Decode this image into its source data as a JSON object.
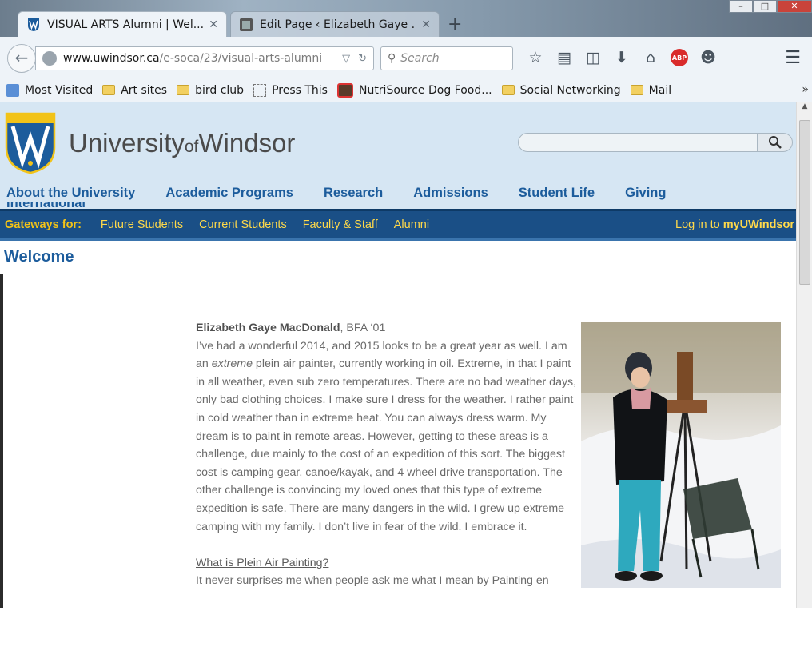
{
  "browser": {
    "tabs": [
      {
        "title": "VISUAL ARTS Alumni | Wel...",
        "active": true
      },
      {
        "title": "Edit Page ‹ Elizabeth Gaye ...",
        "active": false
      }
    ],
    "url_host": "www.uwindsor.ca",
    "url_path": "/e-soca/23/visual-arts-alumni",
    "search_placeholder": "Search",
    "abp_label": "ABP",
    "bookmarks": [
      {
        "label": "Most Visited",
        "icon": "blue-square"
      },
      {
        "label": "Art sites",
        "icon": "folder"
      },
      {
        "label": "bird club",
        "icon": "folder"
      },
      {
        "label": "Press This",
        "icon": "dashed"
      },
      {
        "label": "NutriSource Dog Food...",
        "icon": "dog"
      },
      {
        "label": "Social Networking",
        "icon": "folder"
      },
      {
        "label": "Mail",
        "icon": "folder"
      }
    ]
  },
  "site": {
    "name_main": "University",
    "name_of": "of",
    "name_end": "Windsor",
    "nav": [
      "About the University",
      "Academic Programs",
      "Research",
      "Admissions",
      "Student Life",
      "Giving"
    ],
    "nav_overflow": "International",
    "gateways_label": "Gateways for:",
    "gateways": [
      "Future Students",
      "Current Students",
      "Faculty & Staff",
      "Alumni"
    ],
    "login_prefix": "Log in to ",
    "login_brand": "myUWindsor",
    "page_title": "Welcome"
  },
  "article": {
    "author": "Elizabeth Gaye MacDonald",
    "degree": ", BFA ‘01",
    "intro_a": "I’ve had a wonderful 2014, and 2015 looks to be a great year as well.  I am an ",
    "intro_em": "extreme",
    "intro_b": " plein air painter, currently working in oil.  Extreme, in that I paint in all weather, even sub zero temperatures.  There are no bad weather days, only bad clothing choices.  I make sure I dress for the weather.  I rather paint in cold weather than in extreme heat.  You can always dress warm.  My dream is to paint in remote areas.  However, getting to these areas is a challenge, due mainly to the cost of an expedition of this sort.  The biggest cost is camping gear, canoe/kayak, and 4 wheel drive transportation.  The other challenge is convincing my loved ones that this type of extreme expedition is safe.  There are many dangers in the wild.  I grew up extreme camping with my family.  I don’t live in fear of the wild.  I embrace it.",
    "subhead": "What is Plein Air Painting?",
    "next": "It never surprises me when people ask me what I mean by Painting en"
  },
  "colors": {
    "header_bg": "#d6e6f3",
    "nav_blue": "#1c5c9c",
    "gateway_bar": "#1a4f86",
    "gold": "#f2c318"
  }
}
